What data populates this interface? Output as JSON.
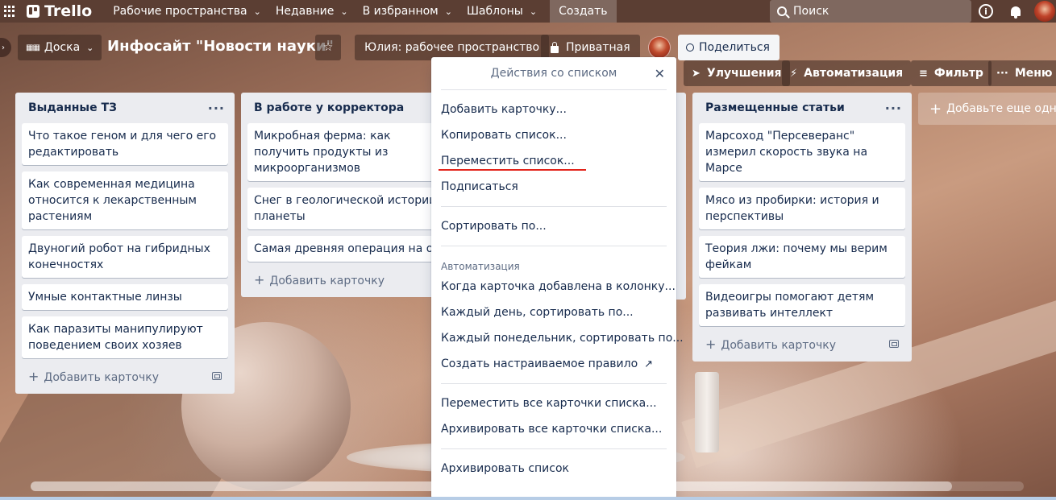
{
  "topbar": {
    "logo": "Trello",
    "nav": [
      {
        "label": "Рабочие пространства"
      },
      {
        "label": "Недавние"
      },
      {
        "label": "В избранном"
      },
      {
        "label": "Шаблоны"
      }
    ],
    "create_label": "Создать",
    "search_placeholder": "Поиск"
  },
  "board": {
    "view_label": "Доска",
    "title": "Инфосайт \"Новости науки\"",
    "workspace_label": "Юлия: рабочее пространство",
    "privacy_label": "Приватная",
    "share_label": "Поделиться",
    "upgrades_label": "Улучшения",
    "automation_label": "Автоматизация",
    "filter_label": "Фильтр",
    "menu_label": "Меню"
  },
  "lists": [
    {
      "title": "Выданные ТЗ",
      "cards": [
        "Что такое геном и для чего его редактировать",
        "Как современная медицина относится к лекарственным растениям",
        "Двуногий робот на гибридных конечностях",
        "Умные контактные линзы",
        "Как паразиты манипулируют поведением своих хозяев"
      ],
      "add_card": "Добавить карточку"
    },
    {
      "title": "В работе у корректора",
      "cards": [
        "Микробная ферма: как получить продукты из микроорганизмов",
        "Снег в геологической истории планеты",
        "Самая древняя операция на орган слуха"
      ],
      "add_card": "Добавить карточку"
    },
    {
      "title": "Размещенные статьи",
      "cards": [
        "Марсоход \"Персеверанс\" измерил скорость звука на Марсе",
        "Мясо из пробирки: история и перспективы",
        "Теория лжи: почему мы верим фейкам",
        "Видеоигры помогают детям развивать интеллект"
      ],
      "add_card": "Добавить карточку"
    }
  ],
  "add_list_label": "Добавьте еще одну ко",
  "popover": {
    "title": "Действия со списком",
    "group1": [
      "Добавить карточку...",
      "Копировать список...",
      "Переместить список...",
      "Подписаться"
    ],
    "group2": [
      "Сортировать по..."
    ],
    "automation_title": "Автоматизация",
    "group3": [
      "Когда карточка добавлена в колонку...",
      "Каждый день, сортировать по...",
      "Каждый понедельник, сортировать по...",
      "Создать настраиваемое правило"
    ],
    "group4": [
      "Переместить все карточки списка...",
      "Архивировать все карточки списка..."
    ],
    "group5": [
      "Архивировать список"
    ]
  },
  "colors": {
    "topbar": "#5b3e33",
    "list_bg": "#ebecf0",
    "highlight_underline": "#e2231a"
  }
}
